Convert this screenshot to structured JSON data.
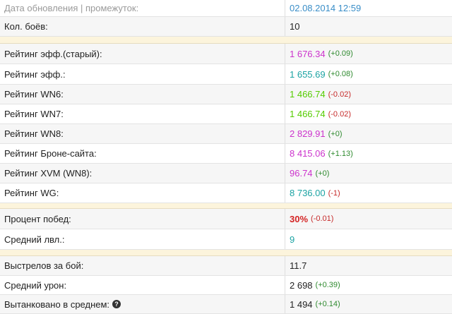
{
  "update": {
    "label": "Дата обновления | промежуток:",
    "value": "02.08.2014 12:59"
  },
  "battles": {
    "label": "Кол. боёв:",
    "value": "10"
  },
  "ratings": [
    {
      "label": "Рейтинг эфф.(старый):",
      "value": "1 676.34",
      "delta": "(+0.09)",
      "color": "#cc33cc"
    },
    {
      "label": "Рейтинг эфф.:",
      "value": "1 655.69",
      "delta": "(+0.08)",
      "color": "#1ba3a3"
    },
    {
      "label": "Рейтинг WN6:",
      "value": "1 466.74",
      "delta": "(-0.02)",
      "color": "#55cc00"
    },
    {
      "label": "Рейтинг WN7:",
      "value": "1 466.74",
      "delta": "(-0.02)",
      "color": "#55cc00"
    },
    {
      "label": "Рейтинг WN8:",
      "value": "2 829.91",
      "delta": "(+0)",
      "color": "#cc33cc"
    },
    {
      "label": "Рейтинг Броне-сайта:",
      "value": "8 415.06",
      "delta": "(+1.13)",
      "color": "#cc33cc"
    },
    {
      "label": "Рейтинг XVM (WN8):",
      "value": "96.74",
      "delta": "(+0)",
      "color": "#cc33cc"
    },
    {
      "label": "Рейтинг WG:",
      "value": "8 736.00",
      "delta": "(-1)",
      "color": "#1ba3a3"
    }
  ],
  "wins": {
    "label": "Процент побед:",
    "value": "30%",
    "delta": "(-0.01)"
  },
  "avg_level": {
    "label": "Средний лвл.:",
    "value": "9"
  },
  "shots": {
    "label": "Выстрелов за бой:",
    "value": "11.7"
  },
  "damage": {
    "label": "Средний урон:",
    "value": "2 698",
    "delta": "(+0.39)"
  },
  "tanked": {
    "label": "Вытанковано в среднем:",
    "value": "1 494",
    "delta": "(+0.14)",
    "help_icon": "question-circle-icon"
  }
}
